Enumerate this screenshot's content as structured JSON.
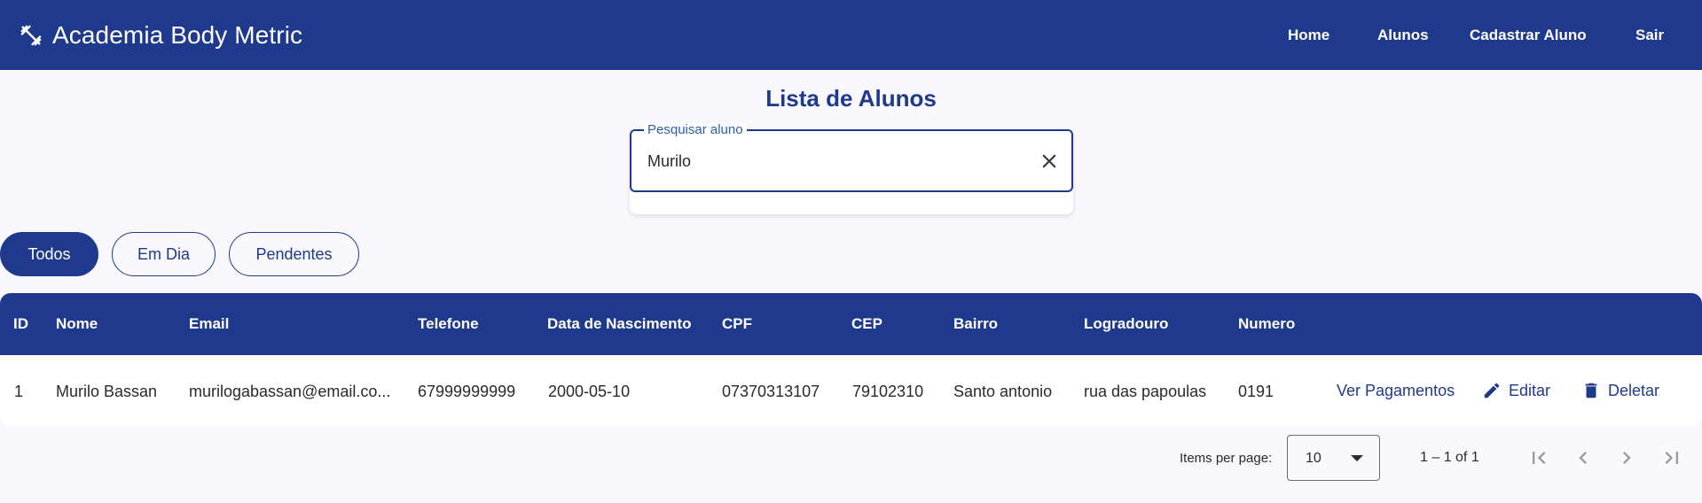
{
  "app": {
    "title": "Academia Body Metric",
    "brand_icon": "dumbbell-icon"
  },
  "nav": {
    "home": "Home",
    "alunos": "Alunos",
    "cadastrar": "Cadastrar Aluno",
    "sair": "Sair"
  },
  "page": {
    "title": "Lista de Alunos"
  },
  "search": {
    "label": "Pesquisar aluno",
    "value": "Murilo",
    "clear_icon": "close-icon"
  },
  "filters": [
    {
      "label": "Todos",
      "active": true
    },
    {
      "label": "Em Dia",
      "active": false
    },
    {
      "label": "Pendentes",
      "active": false
    }
  ],
  "table": {
    "columns": [
      "ID",
      "Nome",
      "Email",
      "Telefone",
      "Data de Nascimento",
      "CPF",
      "CEP",
      "Bairro",
      "Logradouro",
      "Numero"
    ],
    "rows": [
      {
        "id": "1",
        "nome": "Murilo Bassan",
        "email": "murilogabassan@email.co...",
        "telefone": "67999999999",
        "nascimento": "2000-05-10",
        "cpf": "07370313107",
        "cep": "79102310",
        "bairro": "Santo antonio",
        "logradouro": "rua das papoulas",
        "numero": "0191",
        "actions": {
          "pagamentos": "Ver Pagamentos",
          "editar": "Editar",
          "deletar": "Deletar"
        }
      }
    ]
  },
  "paginator": {
    "items_per_page_label": "Items per page:",
    "items_per_page": "10",
    "range": "1 – 1 of 1"
  },
  "colors": {
    "primary": "#1f3a8c",
    "background": "#f9f8fd",
    "label_blue": "#2b5cb0"
  }
}
